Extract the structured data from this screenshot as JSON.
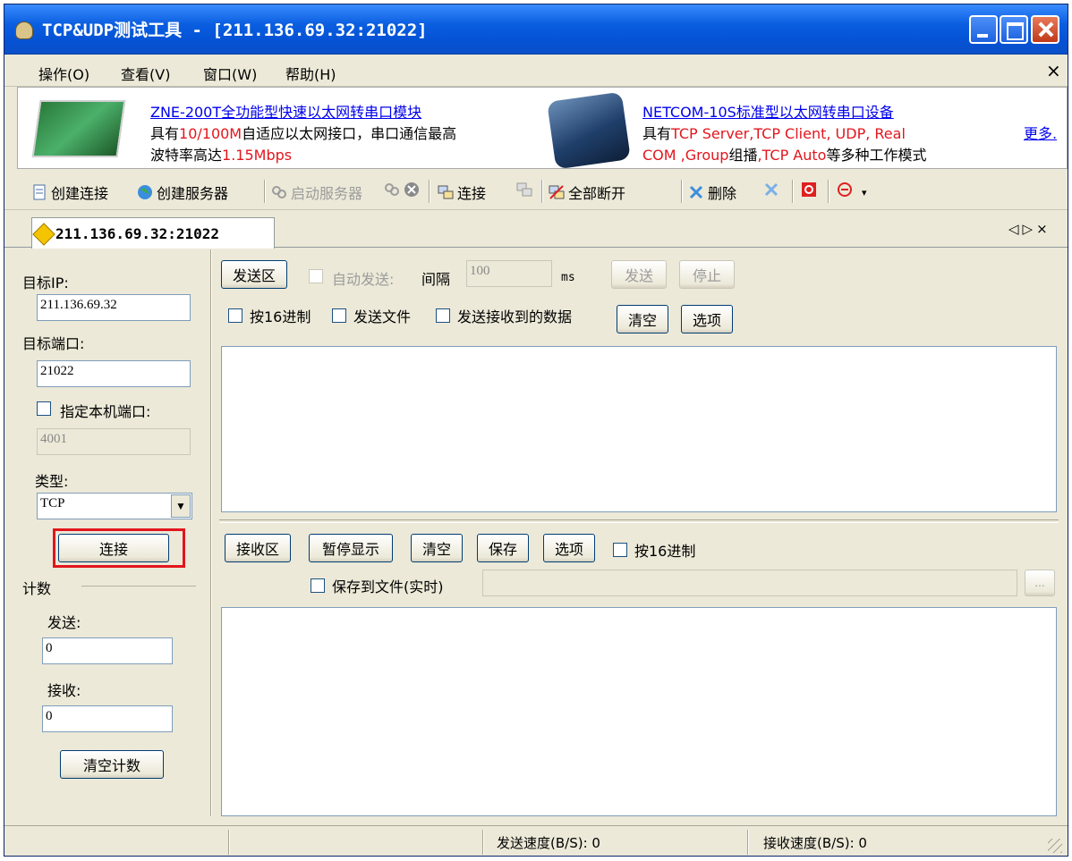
{
  "window": {
    "title": "TCP&UDP测试工具 - [211.136.69.32:21022]"
  },
  "menu": {
    "items": [
      "操作(O)",
      "查看(V)",
      "窗口(W)",
      "帮助(H)"
    ],
    "close": "×"
  },
  "ads": {
    "ad1": {
      "title": "ZNE-200T全功能型快速以太网转串口模块",
      "line2_a": "具有",
      "line2_red": "10/100M",
      "line2_b": "自适应以太网接口，串口通信最高",
      "line3_a": "波特率高达",
      "line3_red": "1.15Mbps"
    },
    "ad2": {
      "title": "NETCOM-10S标准型以太网转串口设备",
      "line2_a": "具有",
      "line2_red": "TCP Server,TCP Client, UDP, Real",
      "line3_red1": "COM ,Group",
      "line3_a": "组播",
      "line3_red2": ",TCP Auto",
      "line3_b": "等多种工作模式"
    },
    "more": "更多."
  },
  "toolbar": {
    "create_connection": "创建连接",
    "create_server": "创建服务器",
    "start_server": "启动服务器",
    "connect": "连接",
    "disconnect_all": "全部断开",
    "delete": "删除"
  },
  "tab": {
    "label": "211.136.69.32:21022",
    "nav": "◁▷×"
  },
  "left": {
    "target_ip_label": "目标IP:",
    "target_ip": "211.136.69.32",
    "target_port_label": "目标端口:",
    "target_port": "21022",
    "local_port_check": "指定本机端口:",
    "local_port": "4001",
    "type_label": "类型:",
    "type_value": "TCP",
    "connect_button": "连接",
    "count_group": "计数",
    "send_label": "发送:",
    "send_count": "0",
    "recv_label": "接收:",
    "recv_count": "0",
    "clear_count_button": "清空计数"
  },
  "send": {
    "area_button": "发送区",
    "auto_send": "自动发送:",
    "interval_label": "间隔",
    "interval_value": "100",
    "interval_unit": "ms",
    "send_button": "发送",
    "stop_button": "停止",
    "hex_check": "按16进制",
    "send_file_check": "发送文件",
    "send_received_check": "发送接收到的数据",
    "clear_button": "清空",
    "options_button": "选项"
  },
  "recv": {
    "area_button": "接收区",
    "pause_button": "暂停显示",
    "clear_button": "清空",
    "save_button": "保存",
    "options_button": "选项",
    "hex_check": "按16进制",
    "save_to_file_check": "保存到文件(实时)",
    "browse_button": "..."
  },
  "status": {
    "send_speed": "发送速度(B/S): 0",
    "recv_speed": "接收速度(B/S): 0"
  },
  "colors": {
    "title_bar": "#0553d6",
    "window_bg": "#ece9d8",
    "highlight": "#e2161d",
    "link": "#0000ee"
  }
}
